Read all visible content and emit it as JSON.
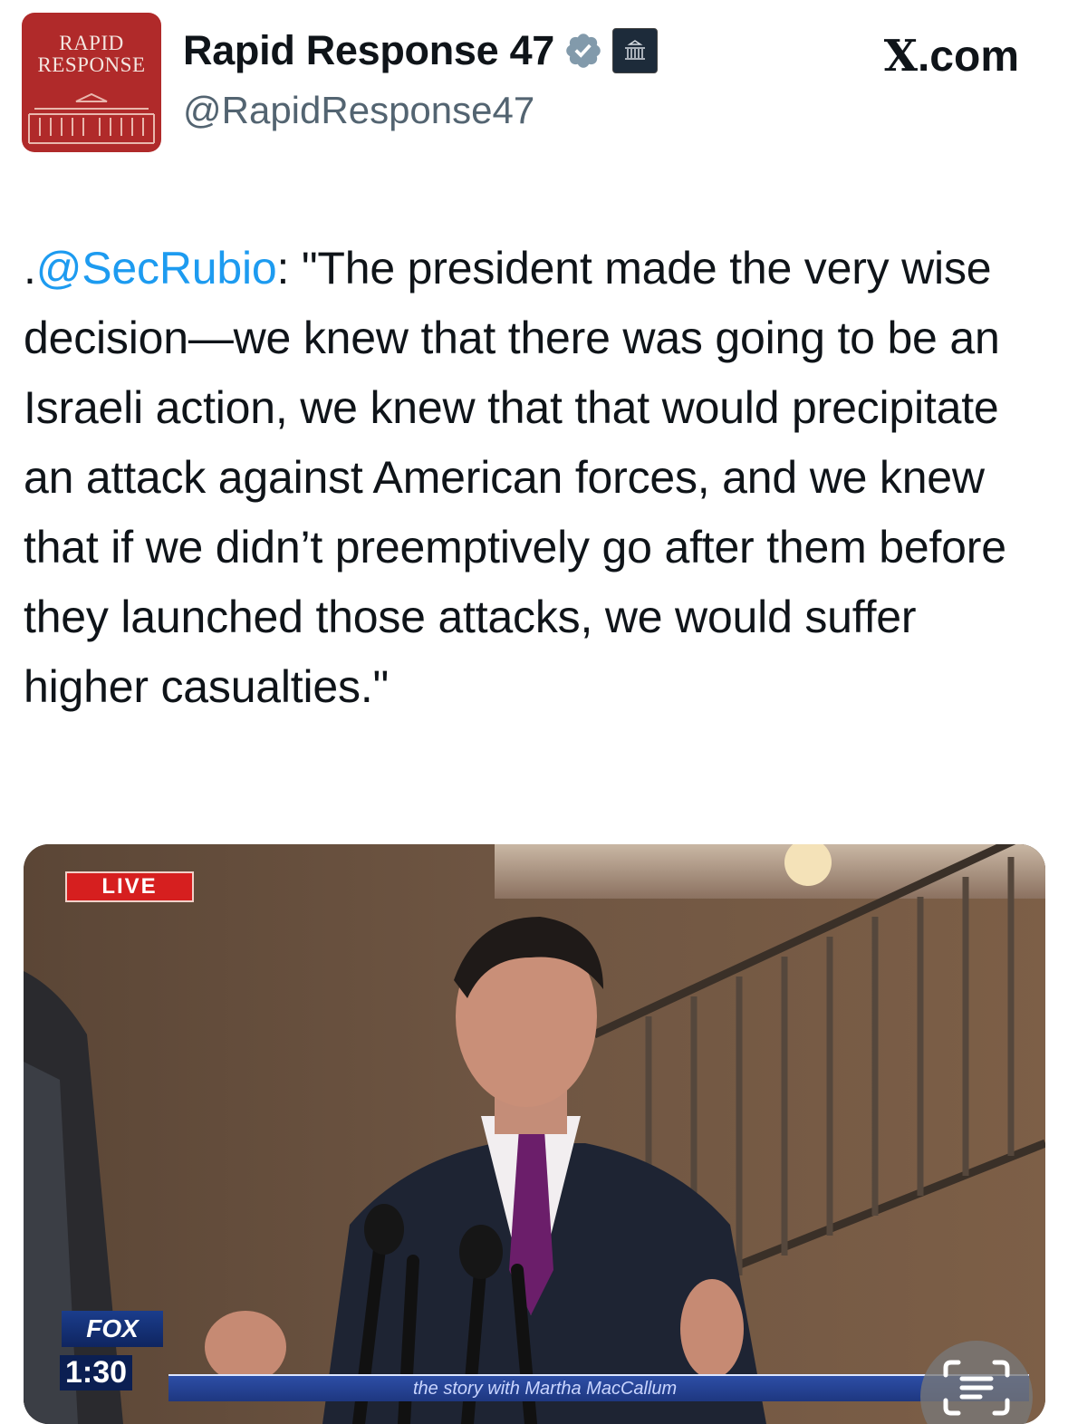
{
  "account": {
    "avatar_text_line1": "RAPID",
    "avatar_text_line2": "RESPONSE",
    "display_name": "Rapid Response 47",
    "handle": "@RapidResponse47",
    "verified_icon": "verified-badge-icon",
    "affiliation_icon": "white-house-badge-icon"
  },
  "source_site": "X.com",
  "tweet": {
    "prefix": ".",
    "mention": "@SecRubio",
    "text": ": \"The president made the very wise decision—we knew that there was going to be an Israeli action, we knew that that would precipitate an attack against American forces, and we knew that if we didn’t preemptively go after them before they launched those attacks, we would suffer higher casualties.\""
  },
  "media": {
    "live_label": "LIVE",
    "network_logo": "FOX",
    "clock": "1:30",
    "ticker_text": "the story with Martha MacCallum",
    "overlay_button_icon": "live-text-icon"
  },
  "colors": {
    "mention": "#1d9bf0",
    "verified": "#829aab",
    "avatar_bg": "#b02a2a",
    "live_red": "#d61f1f"
  }
}
